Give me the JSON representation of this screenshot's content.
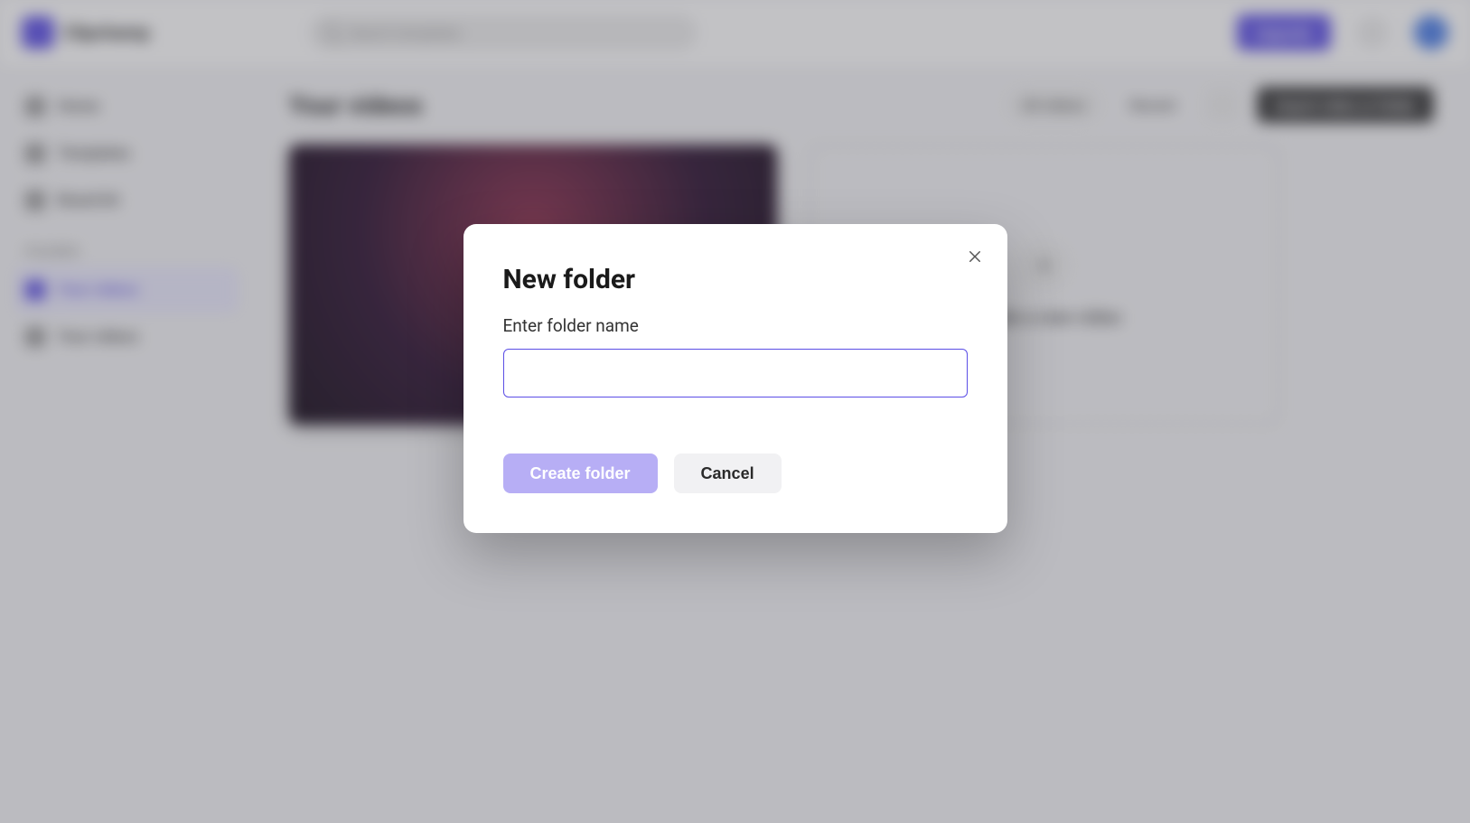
{
  "brand": {
    "name": "Clipchamp"
  },
  "search": {
    "placeholder": "Search templates"
  },
  "header": {
    "cta": "Upgrade"
  },
  "sidebar": {
    "items": [
      {
        "label": "Home"
      },
      {
        "label": "Templates"
      },
      {
        "label": "Brand kit"
      }
    ],
    "section": "FOLDERS",
    "folders": [
      {
        "label": "Your videos"
      },
      {
        "label": "Your videos"
      }
    ]
  },
  "main": {
    "title": "Your videos",
    "filter": "All videos",
    "sort": "Recent",
    "action": "Import video or folder",
    "create": "Create a new video"
  },
  "modal": {
    "title": "New folder",
    "label": "Enter folder name",
    "input_value": "",
    "create": "Create folder",
    "cancel": "Cancel"
  }
}
